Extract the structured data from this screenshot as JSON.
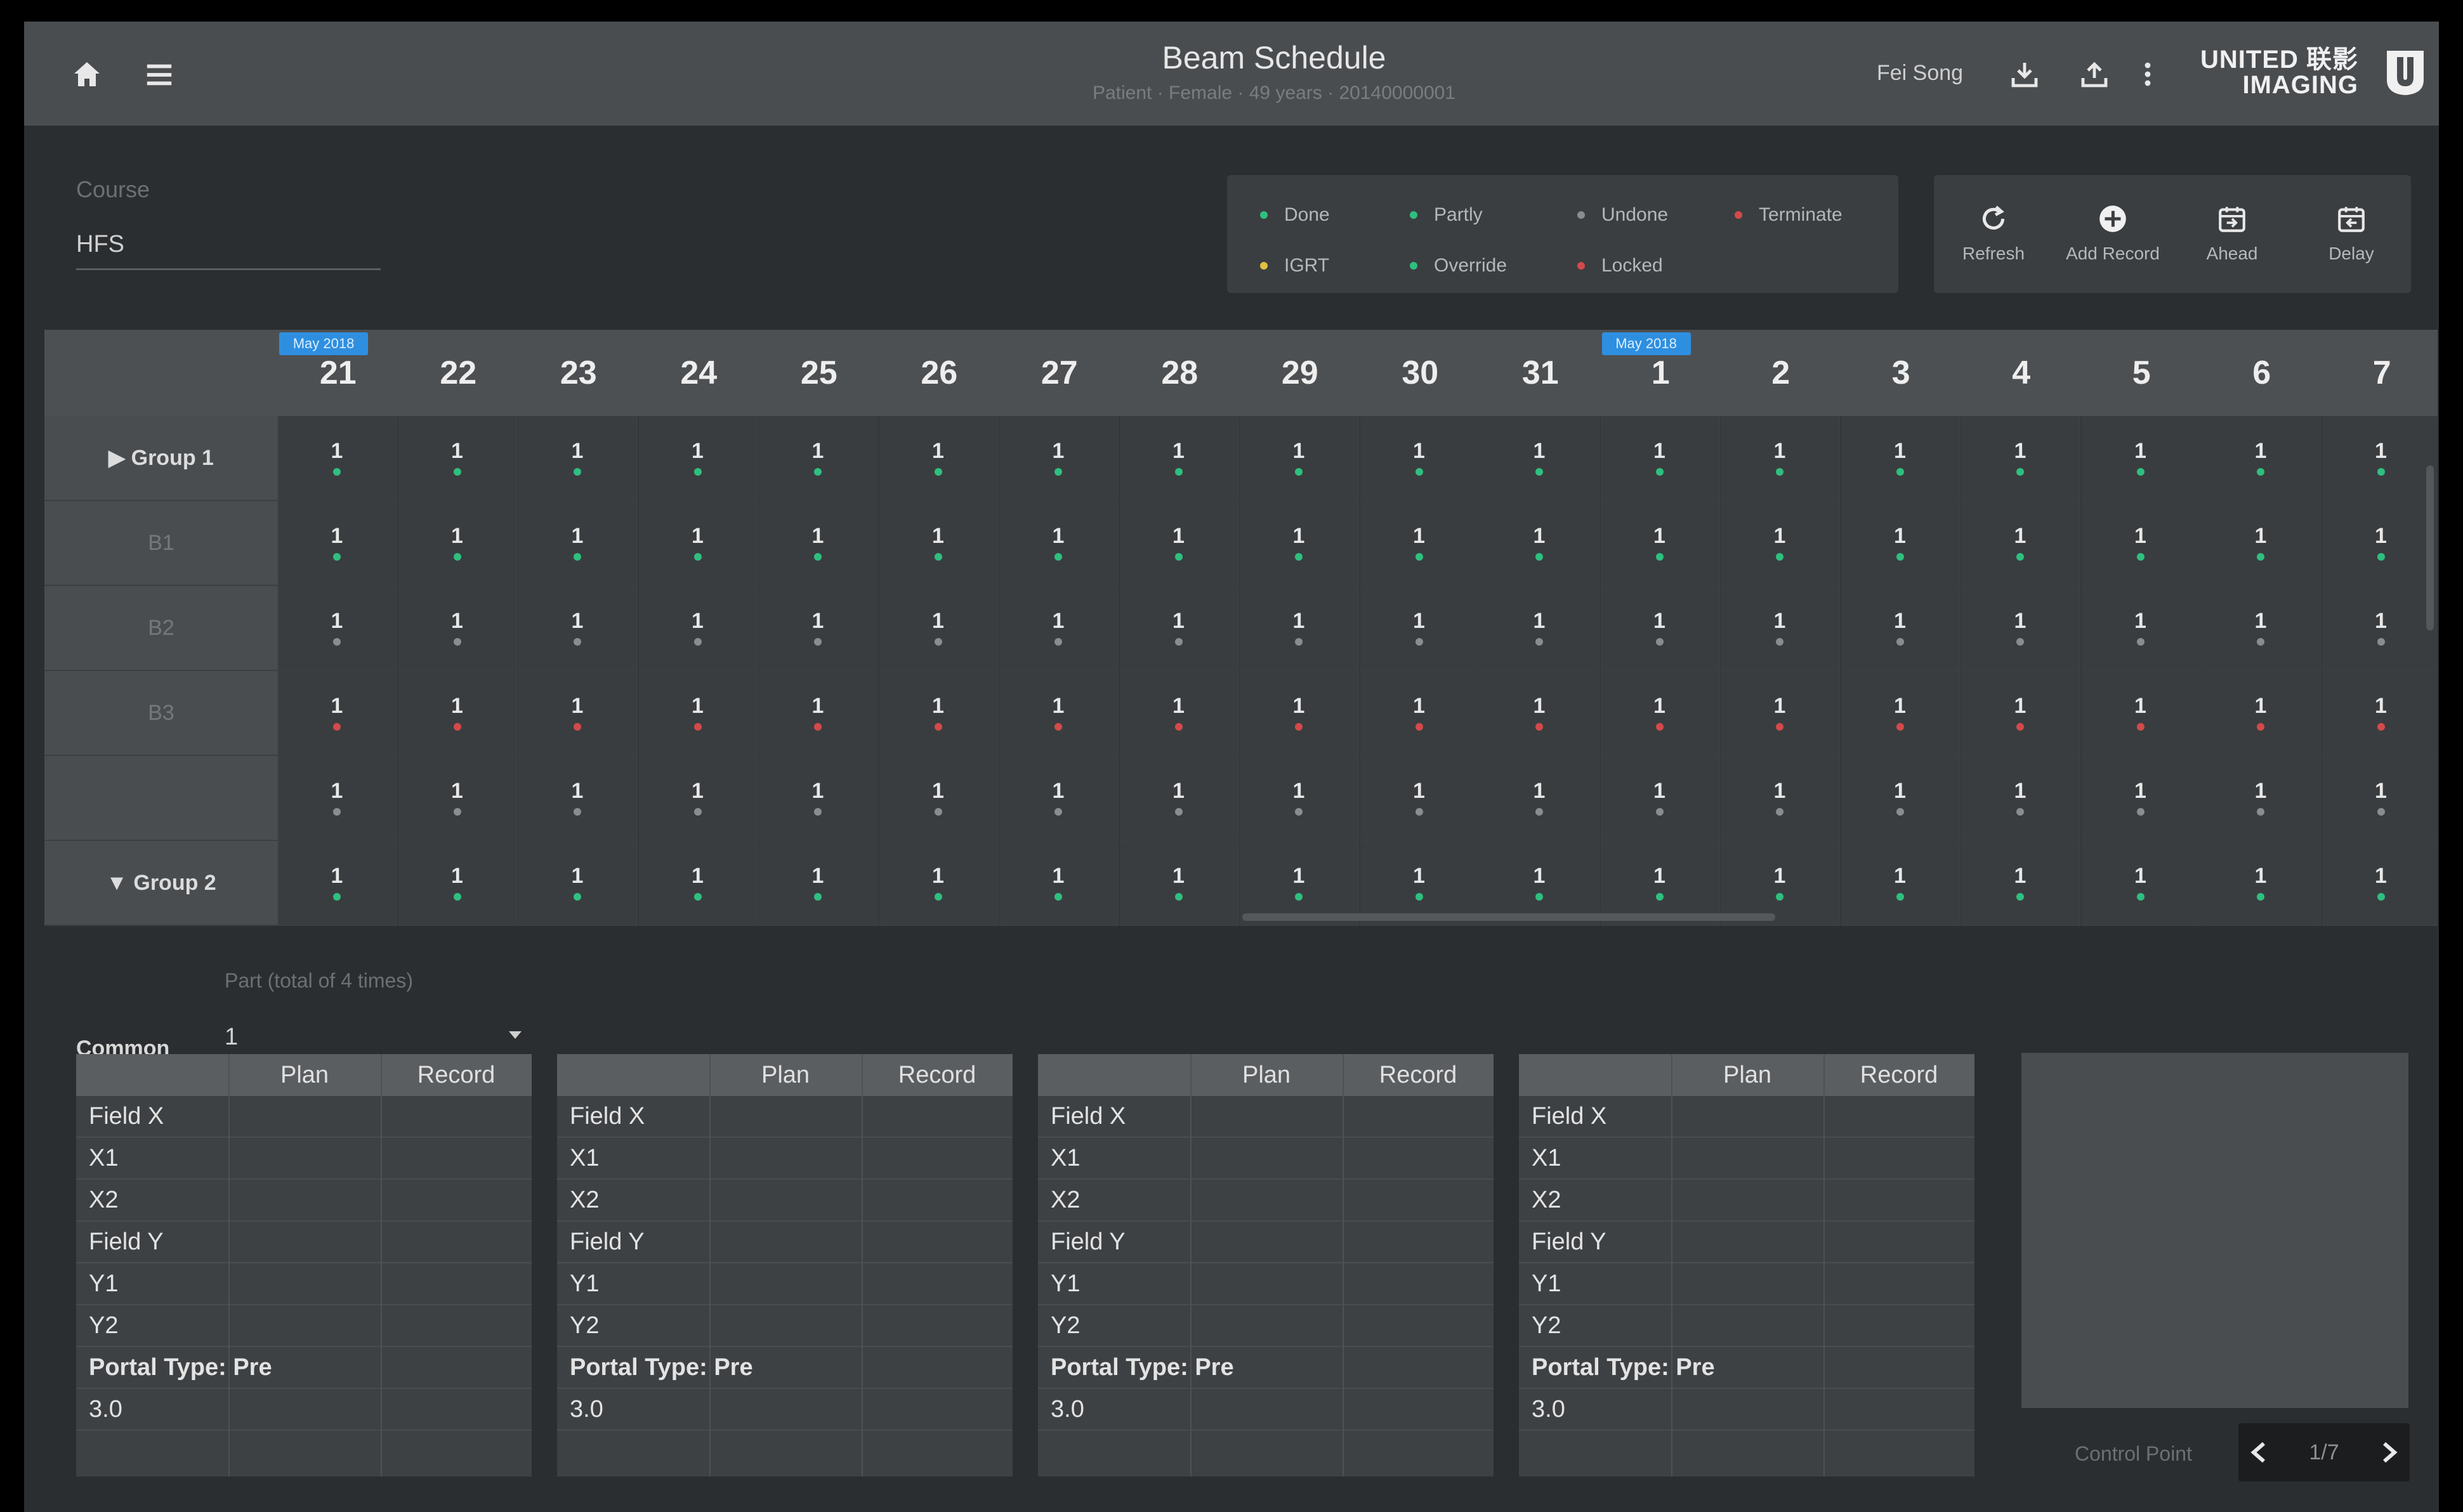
{
  "header": {
    "title": "Beam Schedule",
    "subtitle": "Patient · Female · 49 years · 20140000001",
    "user": "Fei Song",
    "logo_line1": "UNITED 联影",
    "logo_line2": "IMAGING",
    "icons": [
      "home-icon",
      "menu-icon",
      "download-icon",
      "upload-icon",
      "more-icon"
    ]
  },
  "course": {
    "label": "Course",
    "value": "HFS"
  },
  "legend": [
    {
      "label": "Done",
      "color": "#2fbf7f"
    },
    {
      "label": "Partly",
      "color": "#2fbf7f"
    },
    {
      "label": "Undone",
      "color": "#8a8d90"
    },
    {
      "label": "Terminate",
      "color": "#d24a4a"
    },
    {
      "label": "IGRT",
      "color": "#e0c040"
    },
    {
      "label": "Override",
      "color": "#2fbf7f"
    },
    {
      "label": "Locked",
      "color": "#d24a4a"
    }
  ],
  "tools": [
    {
      "label": "Refresh",
      "icon": "refresh-icon"
    },
    {
      "label": "Add Record",
      "icon": "add-record-icon"
    },
    {
      "label": "Ahead",
      "icon": "ahead-icon"
    },
    {
      "label": "Delay",
      "icon": "delay-icon"
    }
  ],
  "schedule": {
    "month_tags": [
      {
        "label": "May 2018",
        "index": 0
      },
      {
        "label": "May 2018",
        "index": 11
      }
    ],
    "dates": [
      "21",
      "22",
      "23",
      "24",
      "25",
      "26",
      "27",
      "28",
      "29",
      "30",
      "31",
      "1",
      "2",
      "3",
      "4",
      "5",
      "6",
      "7"
    ],
    "rows": [
      {
        "label": "▶ Group 1",
        "dim": false,
        "status": "done"
      },
      {
        "label": "B1",
        "dim": true,
        "status": "done"
      },
      {
        "label": "B2",
        "dim": true,
        "status": "undone"
      },
      {
        "label": "B3",
        "dim": true,
        "status": "terminate"
      },
      {
        "label": "",
        "dim": true,
        "status": "undone"
      },
      {
        "label": "▼ Group 2",
        "dim": false,
        "status": "done"
      }
    ],
    "cell_value": "1"
  },
  "part": {
    "label": "Part (total of 4 times)",
    "common_label": "Common",
    "common_value": "1"
  },
  "tables": [
    {
      "headers": [
        "Plan",
        "Record"
      ],
      "rows": [
        "Field X",
        "X1",
        "X2",
        "Field Y",
        "Y1",
        "Y2",
        "Portal Type: Pre",
        "3.0"
      ]
    },
    {
      "headers": [
        "Plan",
        "Record"
      ],
      "rows": [
        "Field X",
        "X1",
        "X2",
        "Field Y",
        "Y1",
        "Y2",
        "Portal Type: Pre",
        "3.0"
      ]
    },
    {
      "headers": [
        "Plan",
        "Record"
      ],
      "rows": [
        "Field X",
        "X1",
        "X2",
        "Field Y",
        "Y1",
        "Y2",
        "Portal Type: Pre",
        "3.0"
      ]
    },
    {
      "headers": [
        "Plan",
        "Record"
      ],
      "rows": [
        "Field X",
        "X1",
        "X2",
        "Field Y",
        "Y1",
        "Y2",
        "Portal Type: Pre",
        "3.0"
      ]
    }
  ],
  "control": {
    "label": "Control Point",
    "page": "1/7"
  }
}
